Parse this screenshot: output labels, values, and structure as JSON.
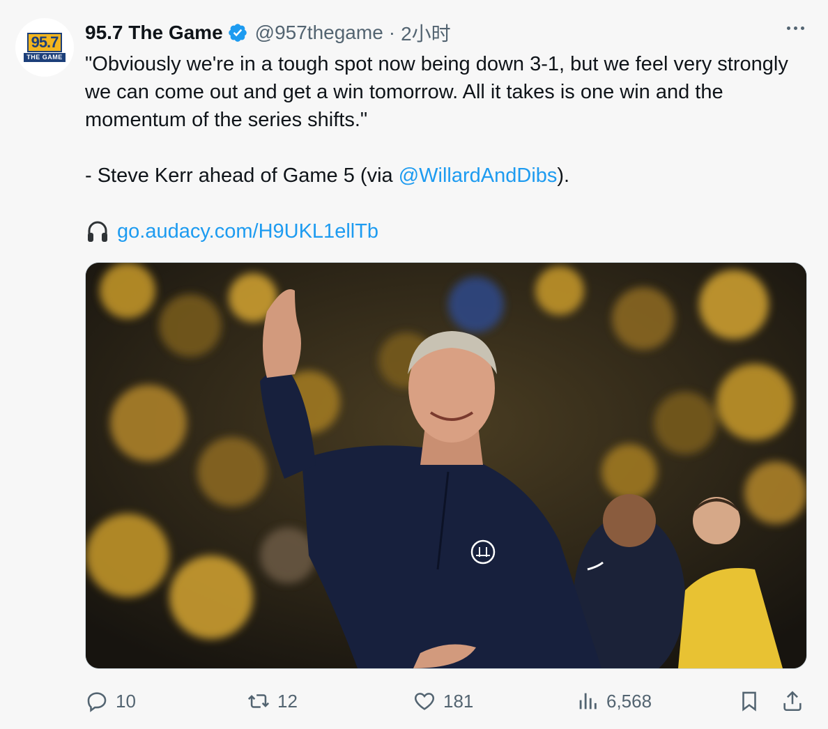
{
  "account": {
    "display_name": "95.7 The Game",
    "handle": "@957thegame",
    "separator": "·",
    "time": "2小时",
    "logo_number": "95.7",
    "logo_sub": "THE GAME",
    "verified_icon": "verified-badge-icon"
  },
  "tweet": {
    "line1": "\"Obviously we're in a tough spot now being down 3-1, but we feel very strongly we can come out and get a win tomorrow. All it takes is one win and the momentum of the series shifts.\"",
    "attribution_prefix": "- Steve Kerr ahead of Game 5 (via ",
    "mention": "@WillardAndDibs",
    "attribution_suffix": ").",
    "link": "go.audacy.com/H9UKL1ellTb",
    "link_icon": "headphones-icon"
  },
  "actions": {
    "replies": "10",
    "retweets": "12",
    "likes": "181",
    "views": "6,568"
  },
  "colors": {
    "accent": "#1d9bf0",
    "muted": "#536471",
    "background": "#f7f7f7"
  }
}
